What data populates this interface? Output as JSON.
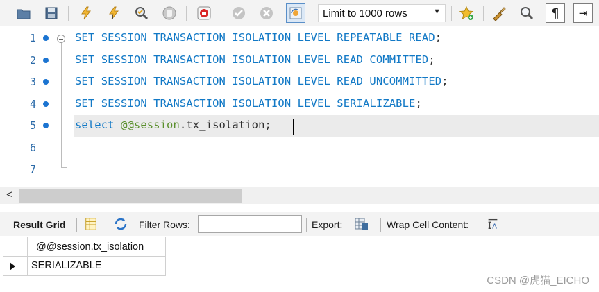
{
  "toolbar": {
    "icons": [
      "open-folder-icon",
      "save-icon",
      "execute-icon",
      "execute-current-icon",
      "explain-icon",
      "stop-icon",
      "toggle-error-stop-icon",
      "commit-icon",
      "rollback-icon",
      "autocommit-icon",
      "bookmark-icon",
      "beautify-icon",
      "find-icon",
      "invisible-chars-icon",
      "wrap-icon"
    ],
    "limit_rows": "Limit to 1000 rows"
  },
  "editor": {
    "lines": [
      {
        "number": "1",
        "breakpoint": true,
        "tokens": [
          {
            "t": "SET SESSION TRANSACTION ISOLATION LEVEL REPEATABLE READ",
            "c": "kw"
          },
          {
            "t": ";",
            "c": "punct"
          }
        ]
      },
      {
        "number": "2",
        "breakpoint": true,
        "tokens": [
          {
            "t": "SET SESSION TRANSACTION ISOLATION LEVEL READ COMMITTED",
            "c": "kw"
          },
          {
            "t": ";",
            "c": "punct"
          }
        ]
      },
      {
        "number": "3",
        "breakpoint": true,
        "tokens": [
          {
            "t": "SET SESSION TRANSACTION ISOLATION LEVEL READ UNCOMMITTED",
            "c": "kw"
          },
          {
            "t": ";",
            "c": "punct"
          }
        ]
      },
      {
        "number": "4",
        "breakpoint": true,
        "tokens": [
          {
            "t": "SET SESSION TRANSACTION ISOLATION LEVEL SERIALIZABLE",
            "c": "kw"
          },
          {
            "t": ";",
            "c": "punct"
          }
        ]
      },
      {
        "number": "5",
        "breakpoint": true,
        "tokens": [
          {
            "t": "select",
            "c": "kw"
          },
          {
            "t": " ",
            "c": "punct"
          },
          {
            "t": "@@session",
            "c": "var"
          },
          {
            "t": ".tx_isolation",
            "c": "id"
          },
          {
            "t": ";",
            "c": "punct"
          }
        ]
      },
      {
        "number": "6",
        "breakpoint": false,
        "tokens": []
      },
      {
        "number": "7",
        "breakpoint": false,
        "tokens": []
      }
    ]
  },
  "result": {
    "tab_label": "Result Grid",
    "filter_label": "Filter Rows:",
    "filter_value": "",
    "export_label": "Export:",
    "wrap_label": "Wrap Cell Content:",
    "columns": [
      "@@session.tx_isolation"
    ],
    "rows": [
      [
        "SERIALIZABLE"
      ]
    ]
  },
  "watermark": "CSDN @虎猫_EICHO",
  "colors": {
    "keyword": "#1279c6",
    "variable": "#5a8f2c",
    "breakpoint": "#1b74d1",
    "line_number": "#2b6aa8"
  }
}
